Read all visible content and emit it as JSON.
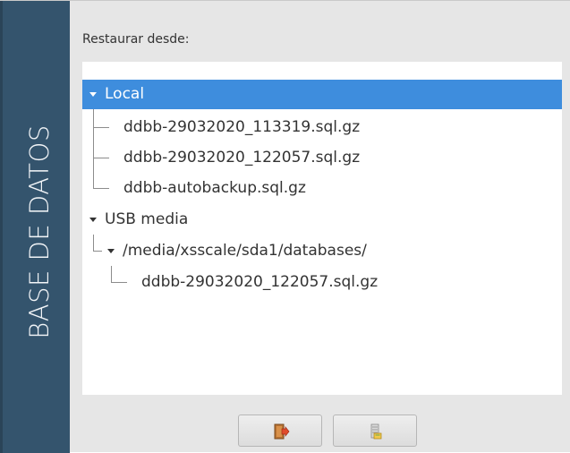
{
  "side_banner": {
    "text": "BASE DE DATOS"
  },
  "restore": {
    "label": "Restaurar desde:"
  },
  "tree": {
    "local": {
      "label": "Local",
      "files": [
        "ddbb-29032020_113319.sql.gz",
        "ddbb-29032020_122057.sql.gz",
        "ddbb-autobackup.sql.gz"
      ]
    },
    "usb": {
      "label": "USB media",
      "folder": "/media/xsscale/sda1/databases/",
      "files": [
        "ddbb-29032020_122057.sql.gz"
      ]
    }
  },
  "buttons": [
    {
      "icon": "exit-door-icon"
    },
    {
      "icon": "restore-database-icon"
    }
  ],
  "colors": {
    "banner": "#34546d",
    "selection": "#3e8ddd",
    "background": "#e6e6e6"
  }
}
